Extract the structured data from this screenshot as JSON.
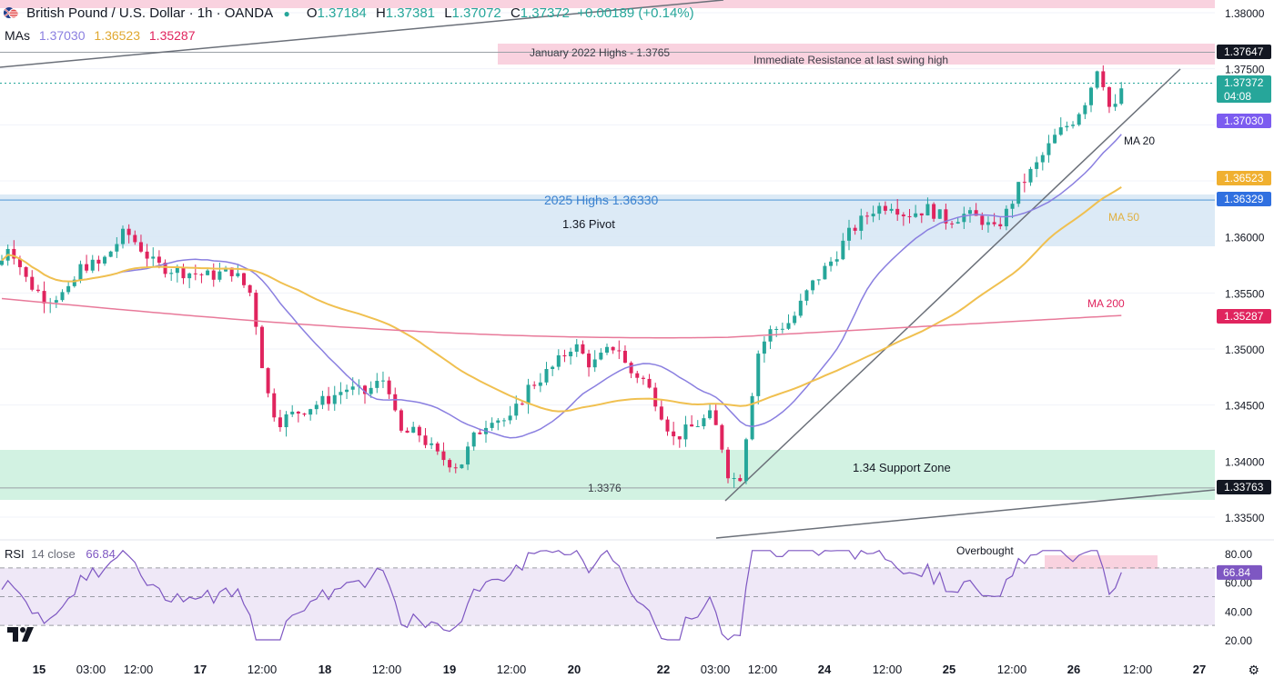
{
  "header": {
    "title": "British Pound / U.S. Dollar · 1h · OANDA",
    "o_label": "O",
    "o_value": "1.37184",
    "h_label": "H",
    "h_value": "1.37381",
    "l_label": "L",
    "l_value": "1.37072",
    "c_label": "C",
    "c_value": "1.37372",
    "change": "+0.00189 (+0.14%)"
  },
  "mas": {
    "label": "MAs",
    "ma20": "1.37030",
    "ma50": "1.36523",
    "ma200": "1.35287"
  },
  "rsi": {
    "label": "RSI",
    "params": "14 close",
    "value": "66.84"
  },
  "colors": {
    "up": "#26a69a",
    "down": "#e0245e",
    "ma20": "#8a7fe0",
    "ma50": "#f0c050",
    "ma200": "#e87a9a",
    "resistance_band": "#f9d2df",
    "pivot_band": "#d8e8f5",
    "support_band": "#d2f2e2",
    "rsi_line": "#7e57c2",
    "rsi_band": "#efe8f7"
  },
  "icons": {
    "flag": "uk-us-flag-icon",
    "logo": "tradingview-logo-icon",
    "settings": "gear-icon"
  },
  "chart_data": {
    "type": "candlestick",
    "ylim": [
      1.3325,
      1.381
    ],
    "y_ticks": [
      "1.38000",
      "1.37500",
      "1.36000",
      "1.35500",
      "1.35000",
      "1.34500",
      "1.34000",
      "1.33500"
    ],
    "x_ticks": [
      "15",
      "03:00",
      "12:00",
      "17",
      "12:00",
      "18",
      "12:00",
      "19",
      "12:00",
      "20",
      "22",
      "03:00",
      "12:00",
      "24",
      "12:00",
      "25",
      "12:00",
      "26",
      "12:00",
      "27"
    ],
    "price_labels": [
      {
        "value": "1.37647",
        "kind": "dark"
      },
      {
        "value": "1.37500",
        "kind": "tick"
      },
      {
        "value": "1.37372",
        "sub": "04:08",
        "kind": "green"
      },
      {
        "value": "1.37030",
        "kind": "ma20"
      },
      {
        "value": "1.36523",
        "kind": "ma50"
      },
      {
        "value": "1.36329",
        "kind": "blue"
      },
      {
        "value": "1.35287",
        "kind": "ma200"
      },
      {
        "value": "1.33763",
        "kind": "dark"
      }
    ],
    "levels": [
      {
        "name": "January 2022 Highs - 1.3765",
        "value": 1.3765
      },
      {
        "name": "2025 Highs 1.36330",
        "value": 1.3633
      },
      {
        "name": "1.3376",
        "value": 1.3376
      }
    ],
    "annotations": [
      "Immediate Resistance at last swing high",
      "1.36 Pivot",
      "1.34 Support Zone",
      "MA 20",
      "MA 50",
      "MA 200",
      "Overbought"
    ],
    "series": [
      {
        "name": "MA 20",
        "type": "line"
      },
      {
        "name": "MA 50",
        "type": "line"
      },
      {
        "name": "MA 200",
        "type": "line"
      }
    ],
    "rsi_panel": {
      "ylim": [
        15,
        85
      ],
      "y_ticks": [
        "80.00",
        "60.00",
        "40.00",
        "20.00"
      ],
      "overbought": 70,
      "oversold": 30,
      "mid": 50,
      "current": 66.84
    }
  }
}
